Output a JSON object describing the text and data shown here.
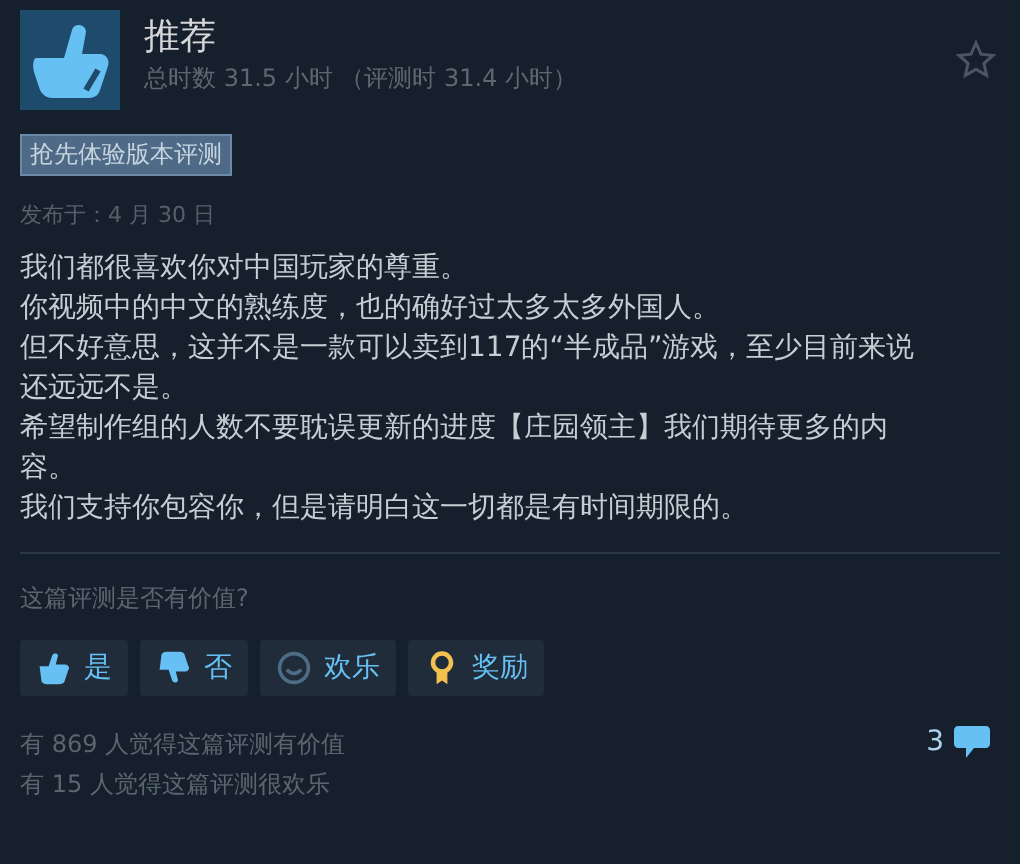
{
  "review": {
    "verdict": "推荐",
    "hours": "总时数 31.5 小时 （评测时 31.4 小时）",
    "badge": "抢先体验版本评测",
    "posted": "发布于：4 月 30 日",
    "paragraphs": [
      "我们都很喜欢你对中国玩家的尊重。",
      "你视频中的中文的熟练度，也的确好过太多太多外国人。",
      "但不好意思，这并不是一款可以卖到117的“半成品”游戏，至少目前来说还远远不是。",
      "希望制作组的人数不要耽误更新的进度【庄园领主】我们期待更多的内容。",
      "我们支持你包容你，但是请明白这一切都是有时间期限的。"
    ]
  },
  "feedback": {
    "question": "这篇评测是否有价值?",
    "buttons": [
      {
        "kind": "yes",
        "label": "是"
      },
      {
        "kind": "no",
        "label": "否"
      },
      {
        "kind": "funny",
        "label": "欢乐"
      },
      {
        "kind": "award",
        "label": "奖励"
      }
    ],
    "helpful": "有 869 人觉得这篇评测有价值",
    "funny": "有 15 人觉得这篇评测很欢乐",
    "comments": "3"
  }
}
